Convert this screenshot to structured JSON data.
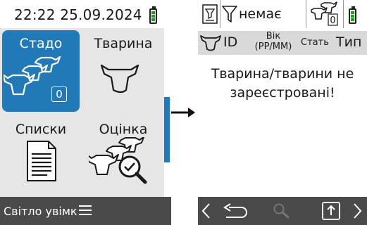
{
  "status": {
    "time": "22:22",
    "date": "25.09.2024"
  },
  "tiles": [
    {
      "label": "Стадо",
      "badge": "0",
      "icon": "herd-icon"
    },
    {
      "label": "Тварина",
      "icon": "cow-head-icon"
    },
    {
      "label": "Списки",
      "icon": "document-icon"
    },
    {
      "label": "Оцінка",
      "icon": "herd-search-icon"
    }
  ],
  "left_footer": {
    "text": "Світло увімк",
    "icon": "menu-icon"
  },
  "filter": {
    "label": "немає",
    "herd_count": "0"
  },
  "columns": {
    "id": "ID",
    "age_line1": "Вік",
    "age_line2": "(РР/ММ)",
    "sex": "Стать",
    "type": "Тип"
  },
  "body": {
    "line1": "Тварина/тварини не",
    "line2": "зареєстровані!"
  },
  "colors": {
    "accent": "#2179b8",
    "footer": "#4a4a4a",
    "battery": "#1e9e1e"
  }
}
